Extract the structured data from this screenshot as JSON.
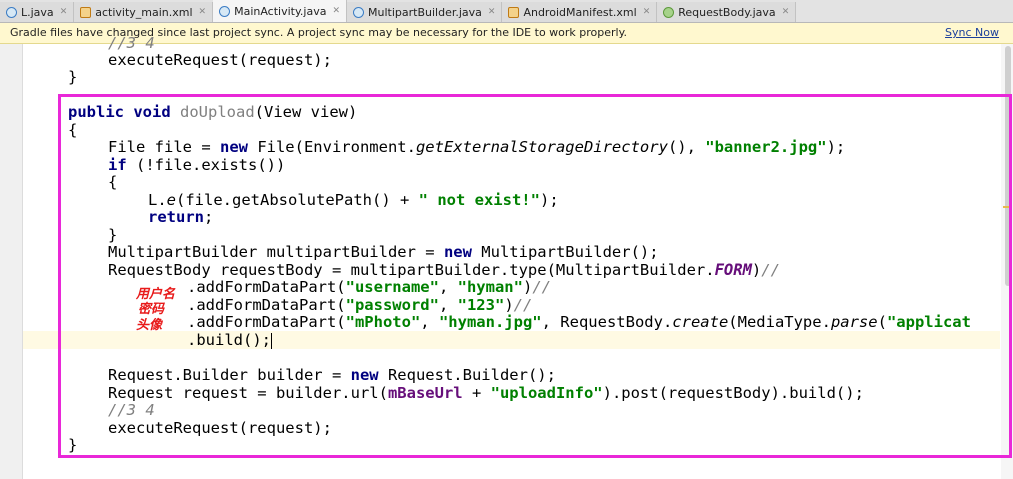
{
  "tabs": [
    {
      "label": "L.java",
      "icon": "class-icon",
      "active": false
    },
    {
      "label": "activity_main.xml",
      "icon": "xml-file-icon",
      "active": false
    },
    {
      "label": "MainActivity.java",
      "icon": "class-icon",
      "active": true
    },
    {
      "label": "MultipartBuilder.java",
      "icon": "class-icon",
      "active": false
    },
    {
      "label": "AndroidManifest.xml",
      "icon": "xml-file-icon",
      "active": false
    },
    {
      "label": "RequestBody.java",
      "icon": "android-class-icon",
      "active": false
    }
  ],
  "notification": {
    "message": "Gradle files have changed since last project sync. A project sync may be necessary for the IDE to work properly.",
    "action": "Sync Now"
  },
  "code": {
    "l0": "//3 4",
    "l1": "executeRequest(request);",
    "l2": "}",
    "l3_kw1": "public",
    "l3_kw2": "void",
    "l3_name": "doUpload",
    "l3_rest": "(View view)",
    "l4": "{",
    "l5_a": "File file = ",
    "l5_new": "new",
    "l5_b": " File(Environment.",
    "l5_method": "getExternalStorageDirectory",
    "l5_c": "(), ",
    "l5_str": "\"banner2.jpg\"",
    "l5_d": ");",
    "l6_kw": "if",
    "l6_rest": " (!file.exists())",
    "l7": "{",
    "l8_a": "L.",
    "l8_method": "e",
    "l8_b": "(file.getAbsolutePath() + ",
    "l8_str": "\" not exist!\"",
    "l8_c": ");",
    "l9_kw": "return",
    "l9_rest": ";",
    "l10": "}",
    "l11_a": "MultipartBuilder multipartBuilder = ",
    "l11_new": "new",
    "l11_b": " MultipartBuilder();",
    "l12_a": "RequestBody requestBody = multipartBuilder.type(MultipartBuilder.",
    "l12_field": "FORM",
    "l12_b": ")",
    "l12_cm": "//",
    "l13_a": ".addFormDataPart(",
    "l13_s1": "\"username\"",
    "l13_b": ", ",
    "l13_s2": "\"hyman\"",
    "l13_c": ")",
    "l13_cm": "//",
    "l14_a": ".addFormDataPart(",
    "l14_s1": "\"password\"",
    "l14_b": ", ",
    "l14_s2": "\"123\"",
    "l14_c": ")",
    "l14_cm": "//",
    "l15_a": ".addFormDataPart(",
    "l15_s1": "\"mPhoto\"",
    "l15_b": ", ",
    "l15_s2": "\"hyman.jpg\"",
    "l15_c": ", RequestBody.",
    "l15_m1": "create",
    "l15_d": "(MediaType.",
    "l15_m2": "parse",
    "l15_e": "(",
    "l15_s3": "\"applicat",
    "l16": ".build();",
    "l17_a": "Request.Builder builder = ",
    "l17_new": "new",
    "l17_b": " Request.Builder();",
    "l18_a": "Request request = builder.url(",
    "l18_field": "mBaseUrl",
    "l18_b": " + ",
    "l18_str": "\"uploadInfo\"",
    "l18_c": ").post(requestBody).build();",
    "l19": "//3 4",
    "l20": "executeRequest(request);",
    "l21": "}"
  },
  "annotations": {
    "username": "用户名",
    "password": "密码",
    "photo": "头像"
  },
  "colors": {
    "highlight_border": "#e928d8",
    "annotation": "#e81a1a",
    "keyword": "#000080",
    "string": "#008000",
    "field": "#660e7a",
    "comment": "#808080"
  }
}
